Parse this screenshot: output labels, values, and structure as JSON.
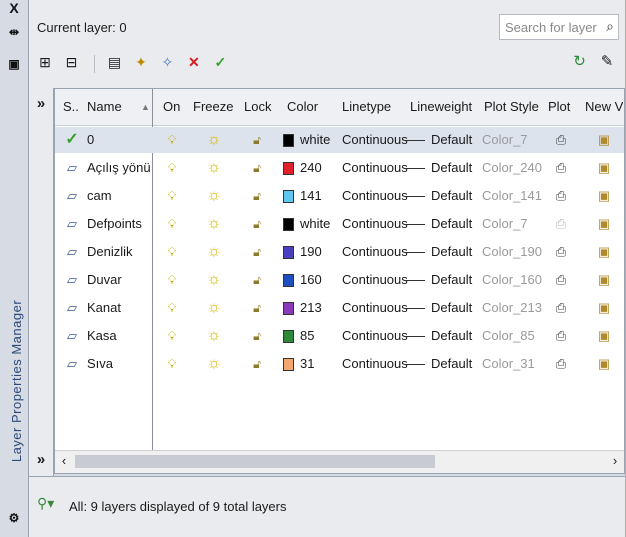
{
  "palette": {
    "title": "Layer Properties Manager",
    "close_glyph": "X"
  },
  "header": {
    "current_layer": "Current layer: 0",
    "search_placeholder": "Search for layer"
  },
  "columns": [
    "S..",
    "Name",
    "On",
    "Freeze",
    "Lock",
    "Color",
    "Linetype",
    "Lineweight",
    "Plot Style",
    "Plot",
    "New VP"
  ],
  "layers": [
    {
      "status": "current",
      "name": "0",
      "color_hex": "#000000",
      "color": "white",
      "linetype": "Continuous",
      "lineweight": "Default",
      "plot_style": "Color_7",
      "plot_enabled": true
    },
    {
      "status": "layer",
      "name": "Açılış yönü",
      "color_hex": "#e0202a",
      "color": "240",
      "linetype": "Continuous",
      "lineweight": "Default",
      "plot_style": "Color_240",
      "plot_enabled": true
    },
    {
      "status": "layer",
      "name": "cam",
      "color_hex": "#5ec8ee",
      "color": "141",
      "linetype": "Continuous",
      "lineweight": "Default",
      "plot_style": "Color_141",
      "plot_enabled": true
    },
    {
      "status": "layer",
      "name": "Defpoints",
      "color_hex": "#000000",
      "color": "white",
      "linetype": "Continuous",
      "lineweight": "Default",
      "plot_style": "Color_7",
      "plot_enabled": false
    },
    {
      "status": "layer",
      "name": "Denizlik",
      "color_hex": "#4a3fbf",
      "color": "190",
      "linetype": "Continuous",
      "lineweight": "Default",
      "plot_style": "Color_190",
      "plot_enabled": true
    },
    {
      "status": "layer",
      "name": "Duvar",
      "color_hex": "#1f4fbf",
      "color": "160",
      "linetype": "Continuous",
      "lineweight": "Default",
      "plot_style": "Color_160",
      "plot_enabled": true
    },
    {
      "status": "layer",
      "name": "Kanat",
      "color_hex": "#8a3ab8",
      "color": "213",
      "linetype": "Continuous",
      "lineweight": "Default",
      "plot_style": "Color_213",
      "plot_enabled": true
    },
    {
      "status": "layer",
      "name": "Kasa",
      "color_hex": "#2e8a3a",
      "color": "85",
      "linetype": "Continuous",
      "lineweight": "Default",
      "plot_style": "Color_85",
      "plot_enabled": true
    },
    {
      "status": "layer",
      "name": "Sıva",
      "color_hex": "#f2a870",
      "color": "31",
      "linetype": "Continuous",
      "lineweight": "Default",
      "plot_style": "Color_31",
      "plot_enabled": true
    }
  ],
  "status_bar": {
    "text": "All: 9 layers displayed of 9 total layers"
  }
}
